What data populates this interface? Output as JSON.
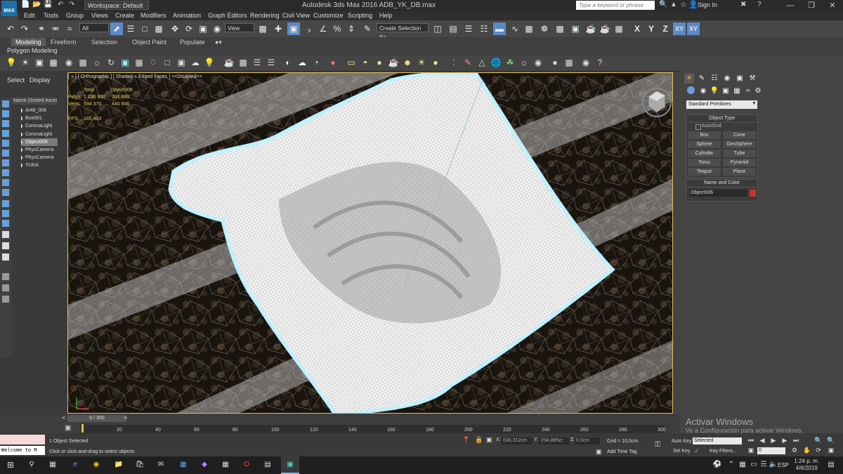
{
  "window": {
    "title": "Autodesk 3ds Max 2016    ADB_YK_DB.max",
    "app_badge": "MAX",
    "workspace": "Workspace: Default",
    "search_placeholder": "Type a keyword or phrase",
    "sign_in": "Sign In"
  },
  "menu": [
    "Edit",
    "Tools",
    "Group",
    "Views",
    "Create",
    "Modifiers",
    "Animation",
    "Graph Editors",
    "Rendering",
    "Civil View",
    "Customize",
    "Scripting",
    "Help"
  ],
  "toolbar": {
    "filter": "All",
    "ref_coord": "View",
    "selection_set": "Create Selection Se",
    "axis_x": "X",
    "axis_y": "Y",
    "axis_z": "Z",
    "axis_xy": "XY",
    "axis_xy2": "XY"
  },
  "ribbon": {
    "tabs": [
      "Modeling",
      "Freeform",
      "Selection",
      "Object Paint",
      "Populate"
    ],
    "active_tab": "Modeling",
    "sub_label": "Polygon Modeling"
  },
  "explorer": {
    "tabs": [
      "Select",
      "Display"
    ],
    "header": "Name (Sorted Ascending)",
    "rows": [
      {
        "name": "AI48_006",
        "selected": false
      },
      {
        "name": "Box001",
        "selected": false
      },
      {
        "name": "CoronaLight",
        "selected": false
      },
      {
        "name": "CoronaLight",
        "selected": false
      },
      {
        "name": "Object006",
        "selected": true
      },
      {
        "name": "PhysCamera",
        "selected": false
      },
      {
        "name": "PhysCamera",
        "selected": false
      },
      {
        "name": "YUKA",
        "selected": false
      }
    ]
  },
  "viewport": {
    "label": "[ + ] [ Orthographic ] [ Shaded + Edged Faces ] <<Disabled>>",
    "stats_header": {
      "c1": "Total",
      "c2": "Object006"
    },
    "stats": [
      {
        "label": "Polys:",
        "total": "1 036 898",
        "object": "381 880"
      },
      {
        "label": "Verts:",
        "total": "594 370",
        "object": "440 946"
      }
    ],
    "fps_label": "FPS:",
    "fps_value": "165,403",
    "mesh_color": "#ffffff",
    "border_color": "#e4c05a"
  },
  "command_panel": {
    "tab_icons": [
      "sun-icon",
      "modify-icon",
      "hierarchy-icon",
      "motion-icon",
      "display-icon",
      "utilities-icon"
    ],
    "dropdown": "Standard Primitives",
    "object_type_title": "Object Type",
    "autogrid": "AutoGrid",
    "primitives": [
      "Box",
      "Cone",
      "Sphere",
      "GeoSphere",
      "Cylinder",
      "Tube",
      "Torus",
      "Pyramid",
      "Teapot",
      "Plane"
    ],
    "name_color_title": "Name and Color",
    "object_name": "Object006",
    "object_color": "#c83232"
  },
  "watermark": {
    "title": "Activar Windows",
    "subtitle": "Ve a Configuración para activar Windows."
  },
  "timeline": {
    "frame": "0 / 300",
    "ticks": [
      "20",
      "40",
      "60",
      "80",
      "100",
      "120",
      "140",
      "160",
      "180",
      "200",
      "220",
      "240",
      "260",
      "280",
      "300"
    ]
  },
  "status": {
    "selected_count": "1 Object Selected",
    "prompt": "Click or click-and-drag to select objects",
    "maxscript": "Welcome to M",
    "x_label": "X:",
    "x": "636,312cm",
    "y_label": "Y:",
    "y": "-294,885cr",
    "z_label": "Z:",
    "z": "0,0cm",
    "grid": "Grid = 10,0cm",
    "add_time_tag": "Add Time Tag",
    "auto_key": "Auto Key",
    "auto_key_value": "Selected",
    "set_key": "Set Key",
    "key_filters": "Key Filters...",
    "frame_value": "0"
  },
  "taskbar": {
    "lang": "ESP",
    "time": "1:24 p. m.",
    "date": "4/6/2019"
  }
}
